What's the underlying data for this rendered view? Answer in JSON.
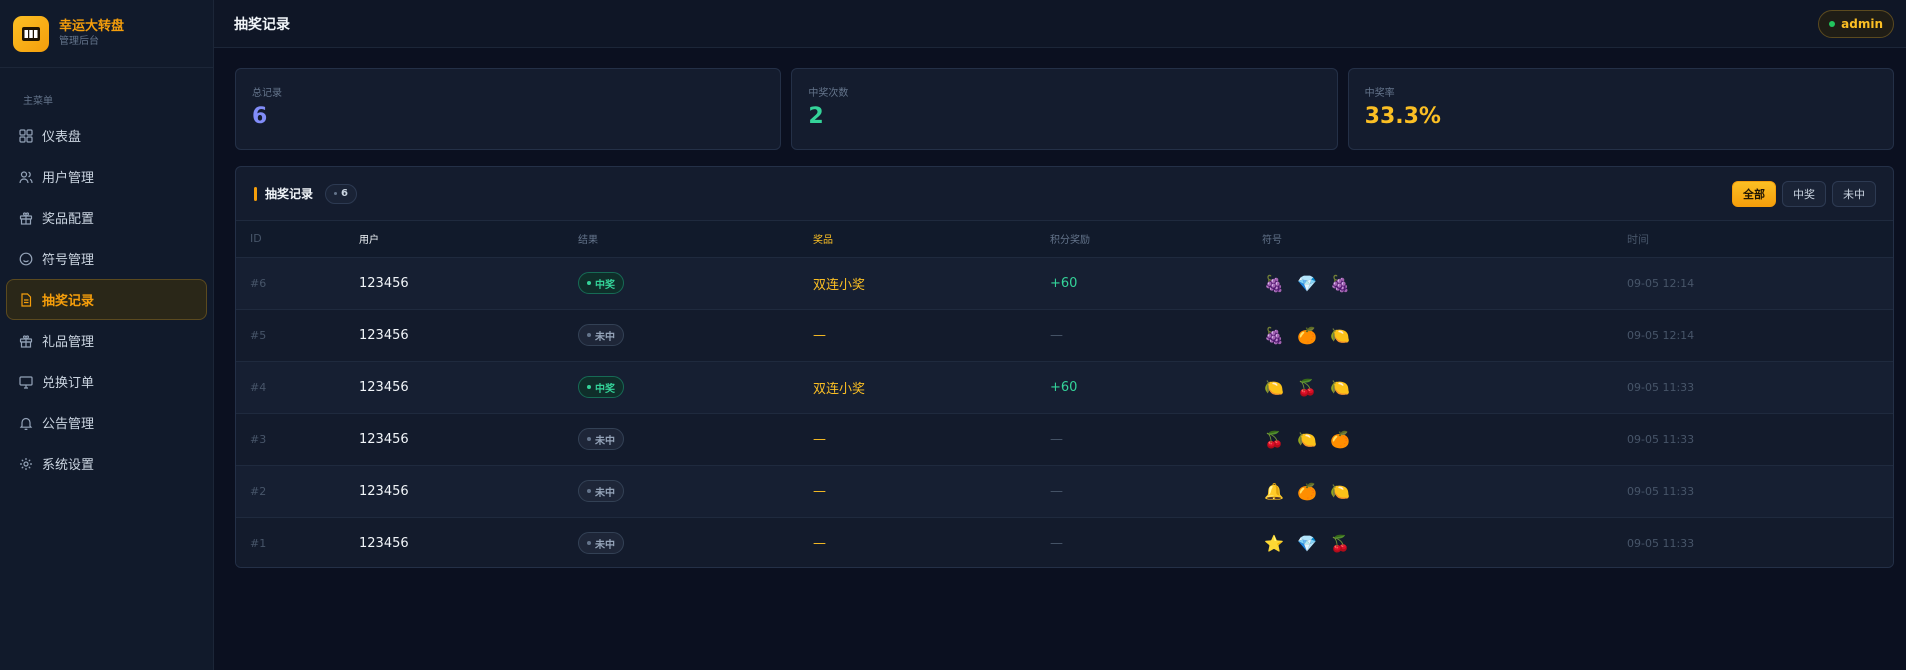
{
  "brand": {
    "title": "幸运大转盘",
    "subtitle": "管理后台"
  },
  "sidebar": {
    "caption": "主菜单",
    "items": [
      {
        "label": "仪表盘",
        "icon": "dashboard-icon"
      },
      {
        "label": "用户管理",
        "icon": "users-icon"
      },
      {
        "label": "奖品配置",
        "icon": "gift-icon"
      },
      {
        "label": "符号管理",
        "icon": "smile-icon"
      },
      {
        "label": "抽奖记录",
        "icon": "document-icon",
        "active": true
      },
      {
        "label": "礼品管理",
        "icon": "gift-icon"
      },
      {
        "label": "兑换订单",
        "icon": "monitor-icon"
      },
      {
        "label": "公告管理",
        "icon": "bell-icon"
      },
      {
        "label": "系统设置",
        "icon": "gear-icon"
      }
    ]
  },
  "header": {
    "title": "抽奖记录",
    "user": "admin"
  },
  "stats": [
    {
      "label": "总记录",
      "value": "6",
      "color": "#818cf8"
    },
    {
      "label": "中奖次数",
      "value": "2",
      "color": "#34d399"
    },
    {
      "label": "中奖率",
      "value": "33.3%",
      "color": "#fbbf24"
    }
  ],
  "panel": {
    "title": "抽奖记录",
    "count": "6",
    "filters": [
      "全部",
      "中奖",
      "未中"
    ],
    "active_filter": "全部"
  },
  "table": {
    "headers": [
      "ID",
      "用户",
      "结果",
      "奖品",
      "积分奖励",
      "符号",
      "时间"
    ],
    "rows": [
      {
        "id": "#6",
        "user": "123456",
        "result": "中奖",
        "win": true,
        "prize": "双连小奖",
        "points": "+60",
        "symbols": [
          "🍇",
          "💎",
          "🍇"
        ],
        "time": "09-05 12:14"
      },
      {
        "id": "#5",
        "user": "123456",
        "result": "未中",
        "win": false,
        "prize": "—",
        "points": "—",
        "symbols": [
          "🍇",
          "🍊",
          "🍋"
        ],
        "time": "09-05 12:14"
      },
      {
        "id": "#4",
        "user": "123456",
        "result": "中奖",
        "win": true,
        "prize": "双连小奖",
        "points": "+60",
        "symbols": [
          "🍋",
          "🍒",
          "🍋"
        ],
        "time": "09-05 11:33"
      },
      {
        "id": "#3",
        "user": "123456",
        "result": "未中",
        "win": false,
        "prize": "—",
        "points": "—",
        "symbols": [
          "🍒",
          "🍋",
          "🍊"
        ],
        "time": "09-05 11:33"
      },
      {
        "id": "#2",
        "user": "123456",
        "result": "未中",
        "win": false,
        "prize": "—",
        "points": "—",
        "symbols": [
          "🔔",
          "🍊",
          "🍋"
        ],
        "time": "09-05 11:33"
      },
      {
        "id": "#1",
        "user": "123456",
        "result": "未中",
        "win": false,
        "prize": "—",
        "points": "—",
        "symbols": [
          "⭐",
          "💎",
          "🍒"
        ],
        "time": "09-05 11:33"
      }
    ]
  }
}
